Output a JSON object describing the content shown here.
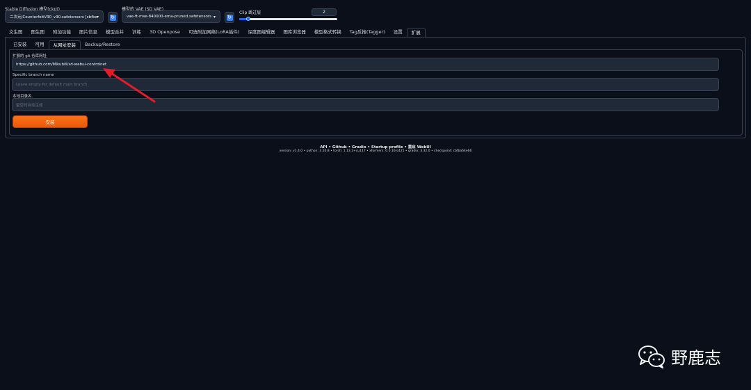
{
  "model": {
    "checkpoint_label": "Stable Diffusion 模型(ckpt)",
    "checkpoint_value": "二次元|CounterfeitV30_v30.safetensors [cbfba",
    "vae_label": "模型的 VAE (SD VAE)",
    "vae_value": "vae-ft-mse-840000-ema-pruned.safetensors",
    "clip_label": "Clip 跳过层",
    "clip_value": "2",
    "clip_range": [
      1,
      12
    ],
    "refresh_icon": "refresh-icon",
    "caret_icon": "chevron-down-icon"
  },
  "main_tabs": [
    "文生图",
    "图生图",
    "附加功能",
    "图片信息",
    "模型合并",
    "训练",
    "3D Openpose",
    "可选附加网络(LoRA插件)",
    "深度图编辑器",
    "图库浏览器",
    "模型格式转换",
    "Tag反推(Tagger)",
    "设置",
    "扩展"
  ],
  "main_tab_active": "扩展",
  "sub_tabs": [
    "已安装",
    "可用",
    "从网址安装",
    "Backup/Restore"
  ],
  "sub_tab_active": "从网址安装",
  "form": {
    "url_label": "扩展的 git 仓库网址",
    "url_value": "https://github.com/Mikubill/sd-webui-controlnet",
    "branch_label": "Specific branch name",
    "branch_placeholder": "Leave empty for default main branch",
    "dir_label": "本地目录名",
    "dir_placeholder": "留空时自动生成",
    "install_label": "安装"
  },
  "footer": {
    "links": "API  •  Github  •  Gradio  •  Startup profile  •  重启 WebUI",
    "version": "version: v1.4.0  •   python: 3.10.8  •   torch: 1.13.1+cu117  •   xformers: 0.0.16rc425  •   gradio: 3.32.0  •   checkpoint: cbfba64e66"
  },
  "watermark": {
    "text": "野鹿志",
    "icon": "wechat-icon"
  },
  "colors": {
    "background": "#0b0f19",
    "accent": "#f97316",
    "arrow": "#e11d2a",
    "slider": "#2563eb"
  }
}
